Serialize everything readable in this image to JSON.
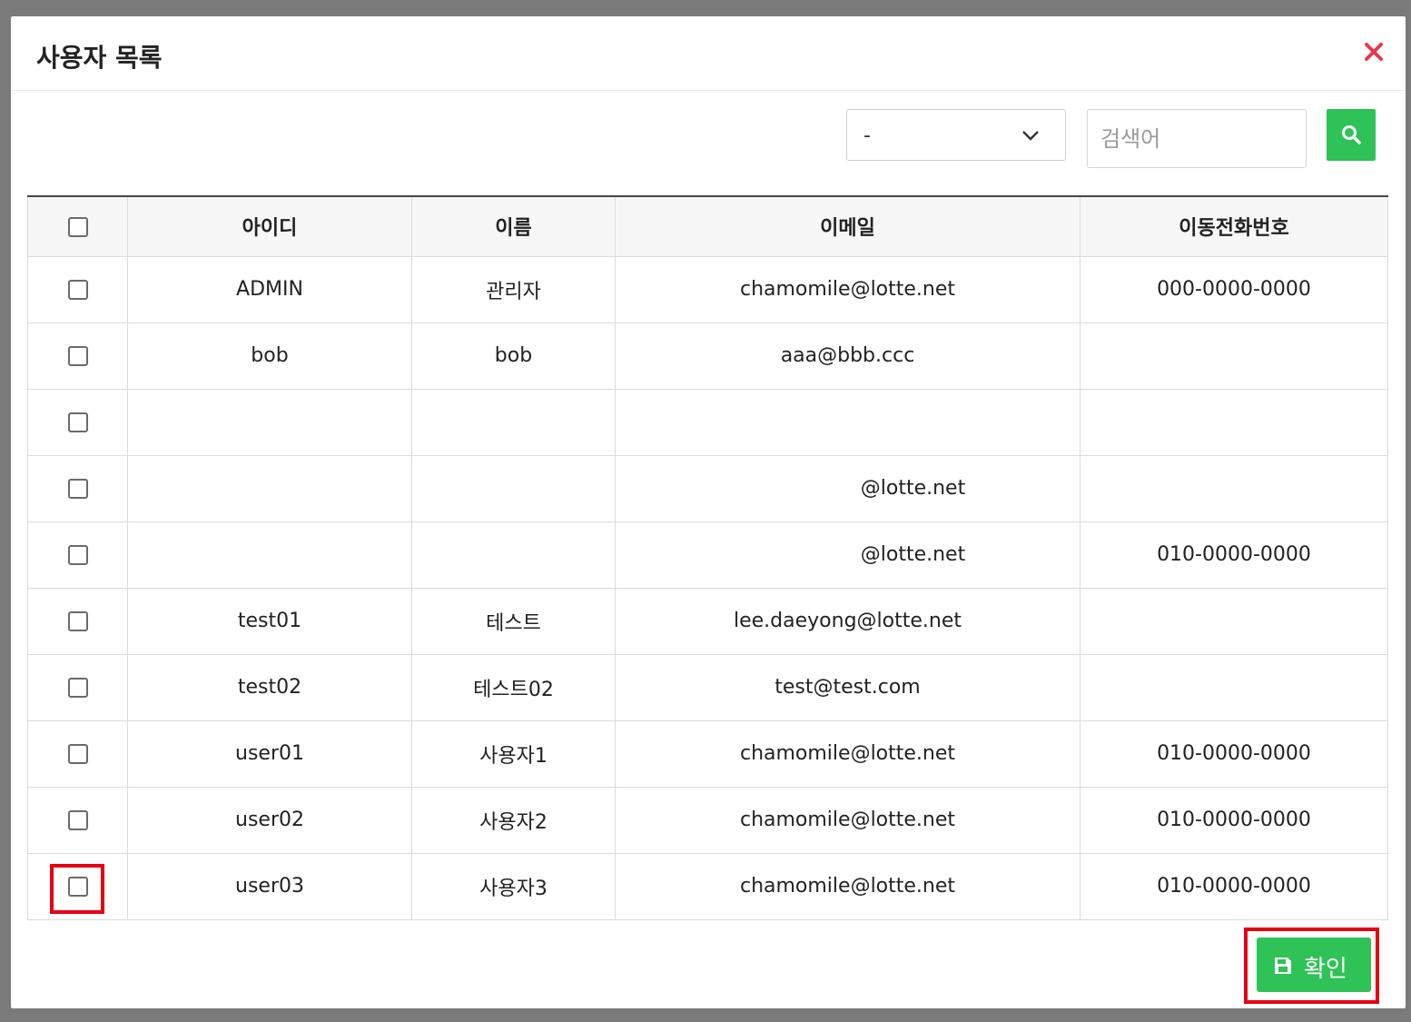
{
  "modal": {
    "title": "사용자 목록",
    "close_icon": "close-icon",
    "accent_color": "#2ec257",
    "close_color": "#e53950"
  },
  "search": {
    "select_value": "-",
    "placeholder": "검색어",
    "value": ""
  },
  "table": {
    "columns": [
      "아이디",
      "이름",
      "이메일",
      "이동전화번호"
    ],
    "rows": [
      {
        "id": "ADMIN",
        "name": "관리자",
        "email": "chamomile@lotte.net",
        "phone": "000-0000-0000"
      },
      {
        "id": "bob",
        "name": "bob",
        "email": "aaa@bbb.ccc",
        "phone": ""
      },
      {
        "id": "",
        "name": "",
        "email": "",
        "phone": ""
      },
      {
        "id": "",
        "name": "",
        "email": "@lotte.net",
        "phone": ""
      },
      {
        "id": "",
        "name": "",
        "email": "@lotte.net",
        "phone": "010-0000-0000"
      },
      {
        "id": "test01",
        "name": "테스트",
        "email": "lee.daeyong@lotte.net",
        "phone": ""
      },
      {
        "id": "test02",
        "name": "테스트02",
        "email": "test@test.com",
        "phone": ""
      },
      {
        "id": "user01",
        "name": "사용자1",
        "email": "chamomile@lotte.net",
        "phone": "010-0000-0000"
      },
      {
        "id": "user02",
        "name": "사용자2",
        "email": "chamomile@lotte.net",
        "phone": "010-0000-0000"
      },
      {
        "id": "user03",
        "name": "사용자3",
        "email": "chamomile@lotte.net",
        "phone": "010-0000-0000"
      }
    ]
  },
  "footer": {
    "confirm_label": "확인"
  }
}
